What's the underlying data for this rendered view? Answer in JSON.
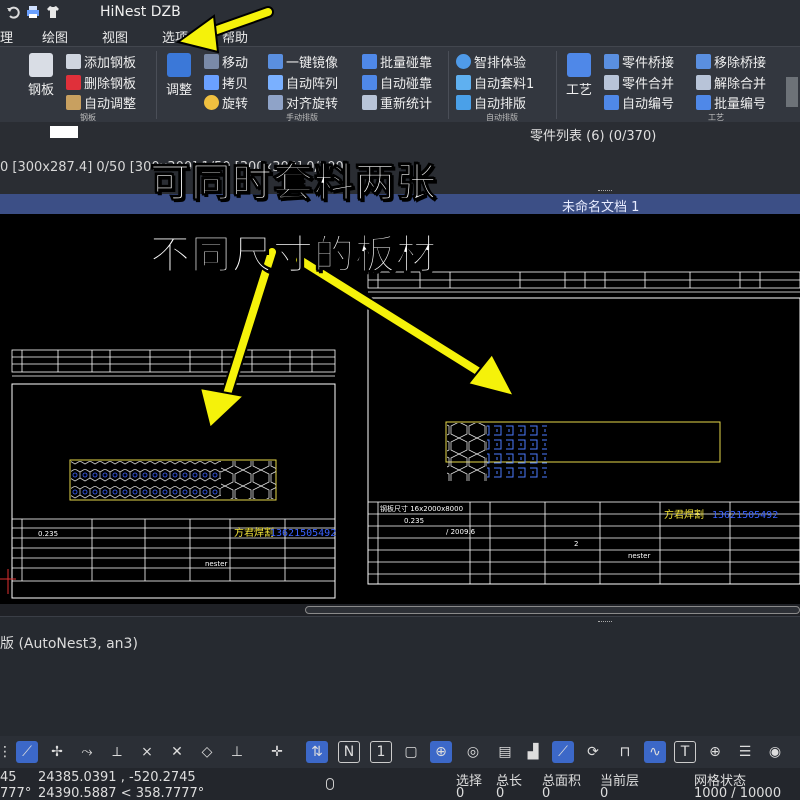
{
  "app": {
    "title": "HiNest DZB"
  },
  "menu": {
    "item1": "理",
    "item2": "绘图",
    "item3": "视图",
    "item4": "选项",
    "item5": "帮助"
  },
  "ribbon": {
    "steel": {
      "big": "钢板",
      "add": "添加钢板",
      "delete": "删除钢板",
      "auto_adjust": "自动调整",
      "group": "钢板"
    },
    "adjust": {
      "big": "调整",
      "move": "移动",
      "copy": "拷贝",
      "rotate": "旋转"
    },
    "manual": {
      "mirror": "一键镜像",
      "auto_array": "自动阵列",
      "align_rotate": "对齐旋转",
      "batch_collide": "批量碰靠",
      "auto_collide": "自动碰靠",
      "recount": "重新统计",
      "group": "手动排版"
    },
    "auto": {
      "smart_try": "智排体验",
      "auto_nest": "自动套料1",
      "auto_layout": "自动排版",
      "group": "自动排版"
    },
    "craft": {
      "big": "工艺",
      "part_bridge": "零件桥接",
      "part_merge": "零件合并",
      "auto_number": "自动编号",
      "remove_bridge": "移除桥接",
      "unmerge": "解除合并",
      "batch_number": "批量编号",
      "group": "工艺"
    }
  },
  "parts_list": {
    "label": "零件列表 (6) (0/370)"
  },
  "info_bar": {
    "text": "0 [300x287.4] 0/50 [300x300] 1/50 [300x300] 0/100"
  },
  "document": {
    "tab": "未命名文档 1"
  },
  "overlay": {
    "line1": "可同时套料两张",
    "line2": "不同尺寸的板材"
  },
  "sheets": {
    "left": {
      "company": "方君焊割",
      "phone": "13621505492",
      "thickness": "0.235",
      "operator": "nester"
    },
    "right": {
      "company": "方君焊割",
      "phone": "13621505492",
      "size": "钢板尺寸 16x2000x8000",
      "thickness": "0.235",
      "rate": "/ 2009.6",
      "count": "2",
      "operator": "nester"
    }
  },
  "command": {
    "line": "版 (AutoNest3, an3)"
  },
  "status": {
    "coord1": "24385.0391 , -520.2745",
    "coord2": "24390.5887 < 358.7777°",
    "left1": "45",
    "left2": "777°",
    "select": "选择",
    "select_val": "0",
    "total_len": "总长",
    "total_len_val": "0",
    "total_area": "总面积",
    "total_area_val": "0",
    "layer": "当前层",
    "layer_val": "0",
    "grid": "网格状态",
    "grid_val": "1000 / 10000"
  },
  "toolbar": {
    "n": "N",
    "one": "1"
  },
  "colors": {
    "accent": "#3c4f86",
    "arrow": "#f5f20a",
    "table_line": "#ffffff",
    "part_blue": "#2f5cff"
  }
}
